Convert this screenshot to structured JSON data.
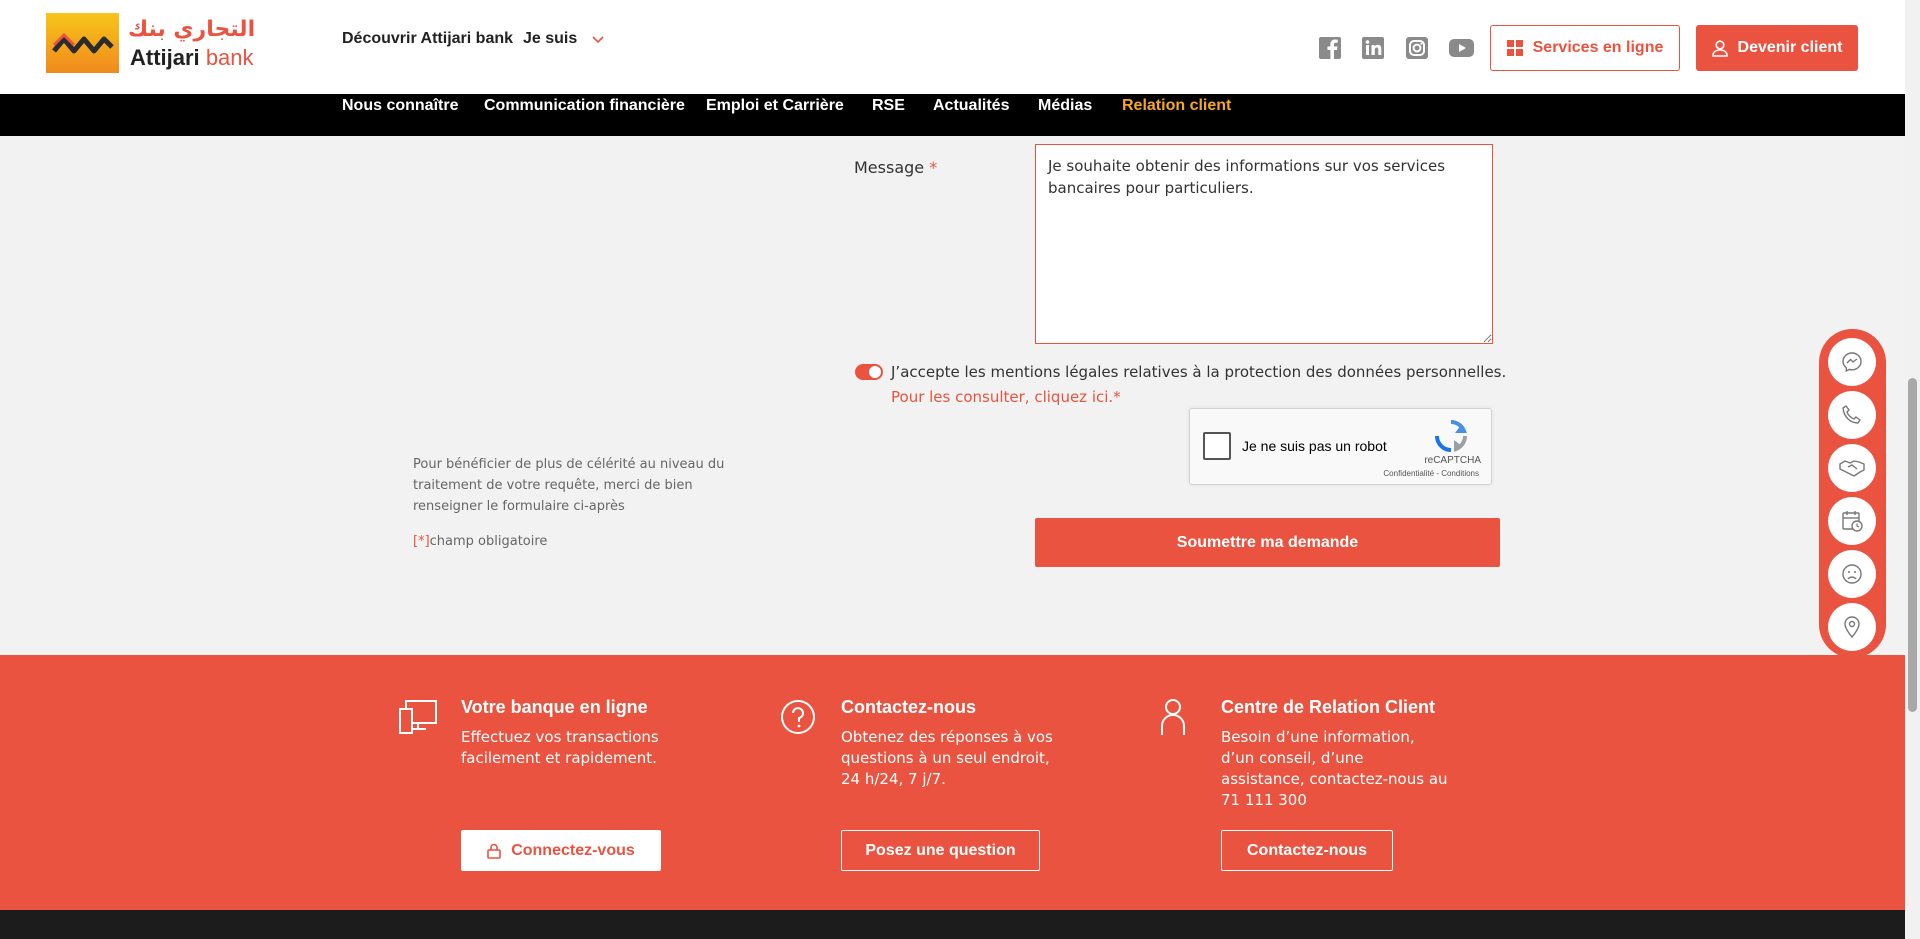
{
  "brand": {
    "arabic": "التجاري بنك",
    "name_bold": "Attijari",
    "name_light": "bank"
  },
  "topnav": {
    "discover": "Découvrir Attijari bank",
    "jesuis": "Je suis",
    "services_button": "Services en ligne",
    "client_button": "Devenir client"
  },
  "mainnav": {
    "items": [
      "Nous connaître",
      "Communication financière",
      "Emploi et Carrière",
      "RSE",
      "Actualités",
      "Médias",
      "Relation client"
    ],
    "active": "Relation client"
  },
  "form": {
    "message_label": "Message",
    "required_mark": "*",
    "message_value": "Je souhaite obtenir des informations sur vos services bancaires pour particuliers.",
    "consent_text": "J’accepte les mentions légales relatives à la protection des données personnelles.",
    "consent_link": "Pour les consulter, cliquez ici.*",
    "consent_checked": true,
    "submit_label": "Soumettre ma demande"
  },
  "recaptcha": {
    "label": "Je ne suis pas un robot",
    "brand": "reCAPTCHA",
    "terms": "Confidentialité - Conditions"
  },
  "sidebar_info": {
    "text": "Pour bénéficier de plus de célérité au niveau du traitement de votre requête, merci de bien renseigner le formulaire ci-après",
    "req_mark": "[*]",
    "req_text": "champ obligatoire"
  },
  "float_panel": {
    "icons": [
      "messenger-icon",
      "phone-icon",
      "handshake-icon",
      "calendar-clock-icon",
      "sad-face-icon",
      "location-pin-icon"
    ]
  },
  "footer": {
    "columns": [
      {
        "icon": "devices-icon",
        "title": "Votre banque en ligne",
        "text": "Effectuez vos transactions facilement et rapidement.",
        "button": "Connectez-vous"
      },
      {
        "icon": "question-icon",
        "title": "Contactez-nous",
        "text": "Obtenez des réponses à vos questions à un seul endroit, 24 h/24, 7 j/7.",
        "button": "Posez une question"
      },
      {
        "icon": "person-icon",
        "title": "Centre de Relation Client",
        "text": "Besoin d’une information, d’un conseil, d’une assistance, contactez-nous au 71 111 300",
        "button": "Contactez-nous"
      }
    ]
  },
  "colors": {
    "accent": "#e9533f",
    "nav_active": "#f5a623",
    "nav_bg": "#000000"
  }
}
